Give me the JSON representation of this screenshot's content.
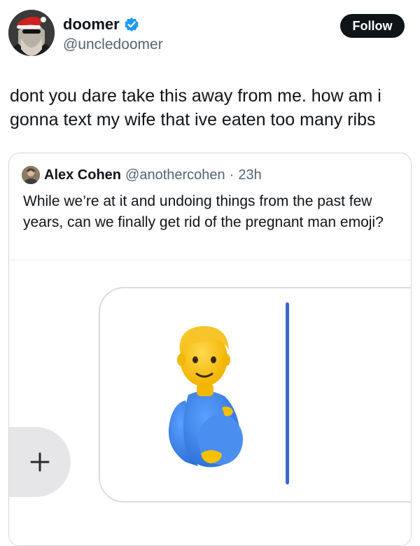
{
  "author": {
    "display_name": "doomer",
    "handle": "@uncledoomer",
    "verified": true
  },
  "follow_label": "Follow",
  "tweet_text": "dont you dare take this away from me. how am i gonna text my wife that ive eaten too many ribs",
  "quoted": {
    "display_name": "Alex Cohen",
    "handle": "@anothercohen",
    "separator": "·",
    "time": "23h",
    "text": "While we’re at it and undoing things from the past few years, can we finally get rid of the pregnant man emoji?"
  },
  "media": {
    "emoji": "pregnant man",
    "plus_label": "+"
  },
  "colors": {
    "verified_blue": "#1d9bf0",
    "follow_bg": "#0f1419",
    "cursor_blue": "#3a67c9"
  }
}
